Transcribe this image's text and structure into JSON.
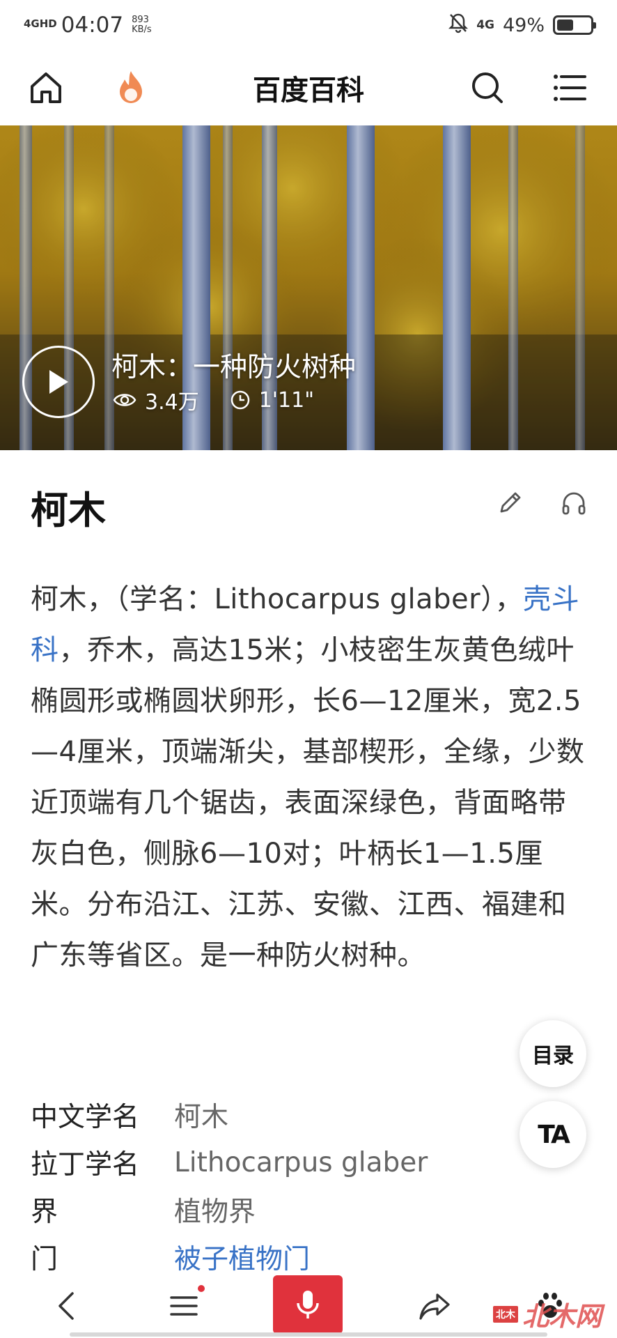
{
  "status_bar": {
    "network": "4GHD",
    "time": "04:07",
    "speed_value": "893",
    "speed_unit": "KB/s",
    "signal": "4G",
    "battery": "49%",
    "battery_level": 0.49
  },
  "app_bar": {
    "title": "百度百科",
    "icons": [
      "home-icon",
      "hot-flame-icon",
      "search-icon",
      "menu-icon"
    ]
  },
  "video": {
    "title": "柯木：一种防火树种",
    "views": "3.4万",
    "duration": "1'11\""
  },
  "entry": {
    "title": "柯木",
    "summary_before_link": "柯木，（学名：Lithocarpus glaber），",
    "summary_link": "壳斗科",
    "summary_after_link": "，乔木，高达15米；小枝密生灰黄色绒叶椭圆形或椭圆状卵形，长6—12厘米，宽2.5—4厘米，顶端渐尖，基部楔形，全缘，少数近顶端有几个锯齿，表面深绿色，背面略带灰白色，侧脉6—10对；叶柄长1—1.5厘米。分布沿江、江苏、安徽、江西、福建和广东等省区。是一种防火树种。"
  },
  "info": [
    {
      "label": "中文学名",
      "value": "柯木"
    },
    {
      "label": "拉丁学名",
      "value": "Lithocarpus glaber"
    },
    {
      "label": "界",
      "value": "植物界"
    },
    {
      "label": "门",
      "value": "被子植物门"
    }
  ],
  "floating": {
    "toc_label": "目录",
    "ta_label": "TA"
  },
  "watermark": {
    "badge": "北木",
    "text": "北木网"
  },
  "colors": {
    "link": "#3872c6",
    "voice_button": "#e0323c",
    "flame": "#f08a54"
  }
}
